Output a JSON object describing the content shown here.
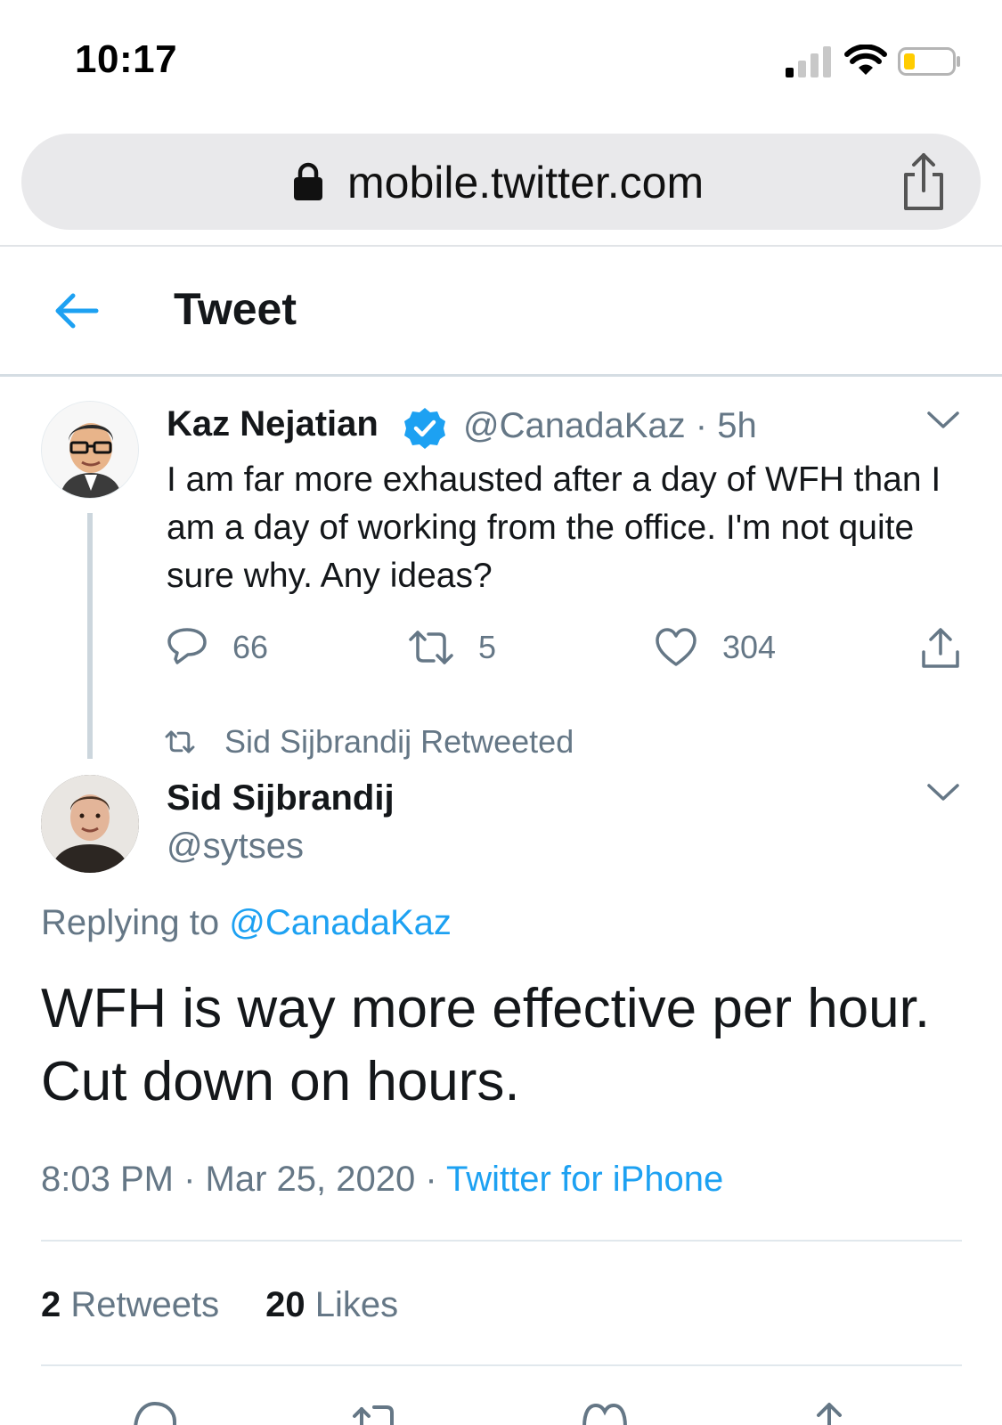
{
  "status_bar": {
    "time": "10:17"
  },
  "browser": {
    "url": "mobile.twitter.com"
  },
  "header": {
    "title": "Tweet"
  },
  "tweet1": {
    "name": "Kaz Nejatian",
    "handle_time": "@CanadaKaz · 5h",
    "text": "I am far more exhausted after a day of WFH than I am a day of working from the office. I'm not quite sure why. Any ideas?",
    "replies": "66",
    "retweets": "5",
    "likes": "304"
  },
  "retweet_banner": "Sid Sijbrandij Retweeted",
  "tweet2": {
    "name": "Sid Sijbrandij",
    "handle": "@sytses",
    "replying_prefix": "Replying to",
    "replying_handle": "@CanadaKaz",
    "text": "WFH is way more effective per hour. Cut down on hours.",
    "timestamp": "8:03 PM · Mar 25, 2020 · ",
    "source": "Twitter for iPhone",
    "retweets_count": "2",
    "retweets_label": "Retweets",
    "likes_count": "20",
    "likes_label": "Likes"
  },
  "colors": {
    "accent": "#1da1f2",
    "muted": "#657786",
    "text": "#14171a"
  }
}
